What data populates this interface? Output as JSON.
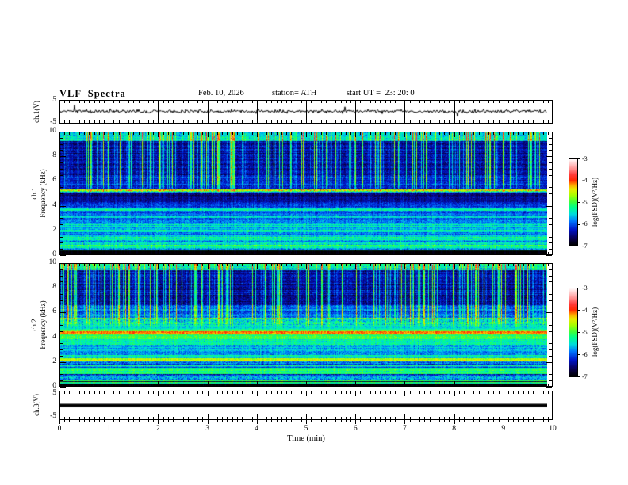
{
  "header": {
    "title": "VLF  Spectra",
    "date": "Feb. 10, 2026",
    "station": "station= ATH",
    "start_ut": "start UT =  23: 20: 0"
  },
  "xaxis": {
    "label": "Time (min)",
    "min": 0,
    "max": 10,
    "ticks": [
      "0",
      "1",
      "2",
      "3",
      "4",
      "5",
      "6",
      "7",
      "8",
      "9",
      "10"
    ],
    "tick_values": [
      0,
      1,
      2,
      3,
      4,
      5,
      6,
      7,
      8,
      9,
      10
    ],
    "minor_step": 0.1,
    "data_end_min": 9.9
  },
  "colorbar": {
    "label": "log(PSD)(V²/Hz)",
    "min": -7,
    "max": -3,
    "ticks": [
      "-3",
      "-4",
      "-5",
      "-6",
      "-7"
    ],
    "tick_values": [
      -3,
      -4,
      -5,
      -6,
      -7
    ]
  },
  "colormap_stops": [
    [
      0.0,
      "#000000"
    ],
    [
      0.08,
      "#0a0050"
    ],
    [
      0.18,
      "#0014c8"
    ],
    [
      0.28,
      "#0078ff"
    ],
    [
      0.36,
      "#00dcdc"
    ],
    [
      0.44,
      "#00ff8c"
    ],
    [
      0.5,
      "#3cff3c"
    ],
    [
      0.58,
      "#aaff00"
    ],
    [
      0.65,
      "#ebeb00"
    ],
    [
      0.7,
      "#ffa000"
    ],
    [
      0.75,
      "#ff2800"
    ],
    [
      0.82,
      "#ff3c3c"
    ],
    [
      0.88,
      "#ff8c8c"
    ],
    [
      0.94,
      "#ffc8c8"
    ],
    [
      1.0,
      "#ffffff"
    ]
  ],
  "chart_data": [
    {
      "type": "line",
      "name": "ch1-waveform",
      "ylabel": "ch.1(V)",
      "ylim": [
        -5,
        5
      ],
      "yticks": [
        "5",
        "-5"
      ],
      "ytick_values": [
        5,
        -5
      ],
      "signal": {
        "kind": "noise",
        "mean": 0.2,
        "sigma": 0.8,
        "spike_prob": 0.012,
        "spike_amp": 2.6
      },
      "line_color": "#000000"
    },
    {
      "type": "heatmap",
      "name": "ch1-spectrogram",
      "ylabel": [
        "ch.1",
        "Frequency (kHz)"
      ],
      "ylim": [
        0,
        10
      ],
      "yticks": [
        "0",
        "2",
        "4",
        "6",
        "8",
        "10"
      ],
      "ytick_values": [
        0,
        2,
        4,
        6,
        8,
        10
      ],
      "yminor_step": 0.5,
      "zlim": [
        -7,
        -3
      ],
      "zunits": "log(PSD)(V²/Hz)",
      "bands": [
        [
          0.0,
          0.3,
          -7.0,
          0.05
        ],
        [
          0.3,
          0.42,
          -5.1,
          0.3
        ],
        [
          0.42,
          0.55,
          -5.7,
          0.4
        ],
        [
          0.55,
          0.75,
          -5.25,
          0.35
        ],
        [
          0.75,
          1.2,
          -5.7,
          0.4
        ],
        [
          1.2,
          1.45,
          -5.35,
          0.3
        ],
        [
          1.45,
          1.8,
          -5.7,
          0.35
        ],
        [
          1.8,
          2.0,
          -5.45,
          0.3
        ],
        [
          2.0,
          2.3,
          -5.8,
          0.3
        ],
        [
          2.3,
          2.5,
          -5.5,
          0.3
        ],
        [
          2.5,
          3.0,
          -5.9,
          0.35
        ],
        [
          3.0,
          3.2,
          -5.55,
          0.3
        ],
        [
          3.2,
          3.6,
          -6.0,
          0.3
        ],
        [
          3.6,
          3.75,
          -5.45,
          0.3
        ],
        [
          3.75,
          4.3,
          -6.1,
          0.3
        ],
        [
          4.3,
          5.05,
          -6.5,
          0.25
        ],
        [
          5.05,
          5.15,
          -5.9,
          0.3
        ],
        [
          5.15,
          5.3,
          -4.9,
          0.6
        ],
        [
          5.3,
          6.5,
          -6.2,
          0.3
        ],
        [
          6.5,
          9.3,
          -6.45,
          0.3
        ],
        [
          9.3,
          10.0,
          -5.55,
          0.35
        ]
      ],
      "streaks": {
        "prob": 0.42,
        "max_boost": 1.7,
        "min_freq": 4.8
      }
    },
    {
      "type": "heatmap",
      "name": "ch2-spectrogram",
      "ylabel": [
        "ch.2",
        "Frequency (kHz)"
      ],
      "ylim": [
        0,
        10
      ],
      "yticks": [
        "0",
        "2",
        "4",
        "6",
        "8",
        "10"
      ],
      "ytick_values": [
        0,
        2,
        4,
        6,
        8,
        10
      ],
      "yminor_step": 0.5,
      "zlim": [
        -7,
        -3
      ],
      "zunits": "log(PSD)(V²/Hz)",
      "bands": [
        [
          0.0,
          0.22,
          -7.0,
          0.05
        ],
        [
          0.22,
          0.32,
          -5.2,
          0.3
        ],
        [
          0.32,
          0.42,
          -6.8,
          0.2
        ],
        [
          0.42,
          0.55,
          -5.1,
          0.3
        ],
        [
          0.55,
          0.95,
          -6.0,
          0.5
        ],
        [
          0.95,
          1.5,
          -5.2,
          0.3
        ],
        [
          1.5,
          1.62,
          -5.9,
          0.3
        ],
        [
          1.62,
          1.72,
          -5.3,
          0.3
        ],
        [
          1.72,
          2.02,
          -5.9,
          0.45
        ],
        [
          2.02,
          2.3,
          -4.55,
          0.3
        ],
        [
          2.3,
          2.55,
          -5.4,
          0.3
        ],
        [
          2.55,
          3.4,
          -5.7,
          0.35
        ],
        [
          3.4,
          3.8,
          -5.3,
          0.3
        ],
        [
          3.8,
          4.25,
          -5.0,
          0.3
        ],
        [
          4.25,
          4.45,
          -4.15,
          0.25
        ],
        [
          4.45,
          4.6,
          -5.0,
          0.3
        ],
        [
          4.6,
          5.0,
          -5.5,
          0.3
        ],
        [
          5.0,
          5.6,
          -5.4,
          0.55
        ],
        [
          5.6,
          6.6,
          -5.95,
          0.35
        ],
        [
          6.6,
          9.5,
          -6.45,
          0.3
        ],
        [
          9.5,
          10.0,
          -5.45,
          0.35
        ]
      ],
      "streaks": {
        "prob": 0.45,
        "max_boost": 1.7,
        "min_freq": 4.6
      }
    },
    {
      "type": "line",
      "name": "ch3-waveform",
      "ylabel": "ch.3(V)",
      "ylim": [
        -5,
        5
      ],
      "yticks": [
        "5",
        "-5"
      ],
      "ytick_values": [
        5,
        -5
      ],
      "signal": {
        "kind": "flat",
        "value": 0.0,
        "thickness_px": 4
      },
      "line_color": "#000000"
    }
  ]
}
